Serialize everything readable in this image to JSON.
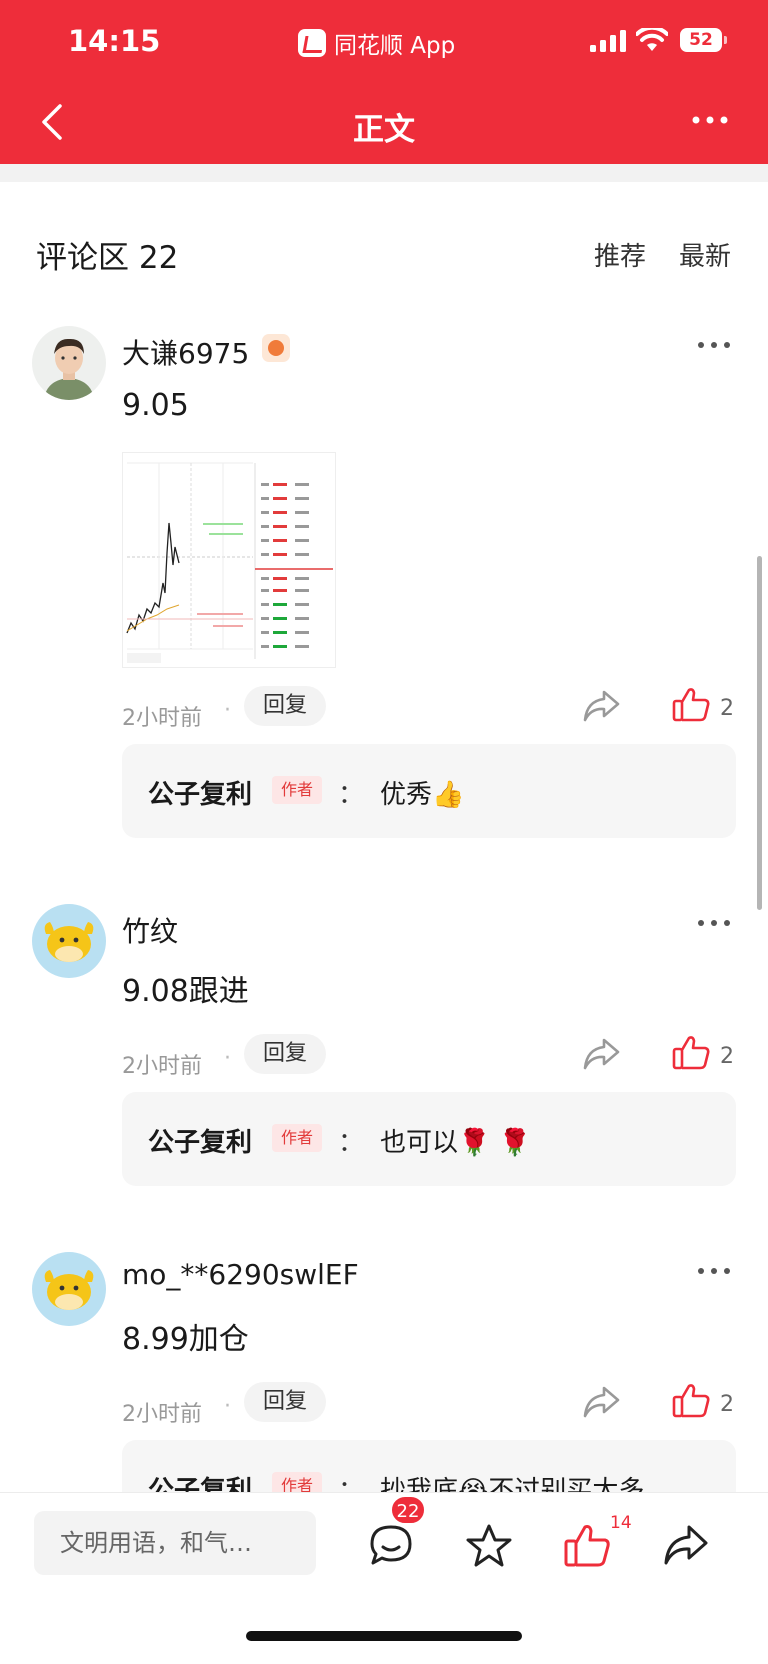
{
  "status_bar": {
    "time": "14:15",
    "app_indicator": "同花顺 App",
    "battery": "52"
  },
  "nav": {
    "title": "正文"
  },
  "comments_header": {
    "title": "评论区 22",
    "sort_recommend": "推荐",
    "sort_latest": "最新"
  },
  "comments": [
    {
      "user": "大谦6975",
      "text": "9.05",
      "time": "2小时前",
      "reply_label": "回复",
      "likes": "2",
      "reply": {
        "name": "公子复利",
        "tag": "作者",
        "colon": "：",
        "text": "优秀👍"
      }
    },
    {
      "user": "竹纹",
      "text": "9.08跟进",
      "time": "2小时前",
      "reply_label": "回复",
      "likes": "2",
      "reply": {
        "name": "公子复利",
        "tag": "作者",
        "colon": "：",
        "text": "也可以🌹 🌹"
      }
    },
    {
      "user": "mo_**6290swlEF",
      "text": "8.99加仓",
      "time": "2小时前",
      "reply_label": "回复",
      "likes": "2",
      "reply": {
        "name": "公子复利",
        "tag": "作者",
        "colon": "：",
        "text": "抄我底😭不过别买太多"
      }
    }
  ],
  "bottom_bar": {
    "input_placeholder": "文明用语，和气…",
    "comment_count": "22",
    "like_count": "14"
  },
  "colors": {
    "brand_red": "#ee2d3a",
    "up_red": "#e23b3b",
    "down_green": "#1ea83a"
  },
  "icons": [
    "back-arrow-icon",
    "more-icon",
    "share-icon",
    "thumbs-up-icon",
    "comment-icon",
    "star-icon"
  ]
}
